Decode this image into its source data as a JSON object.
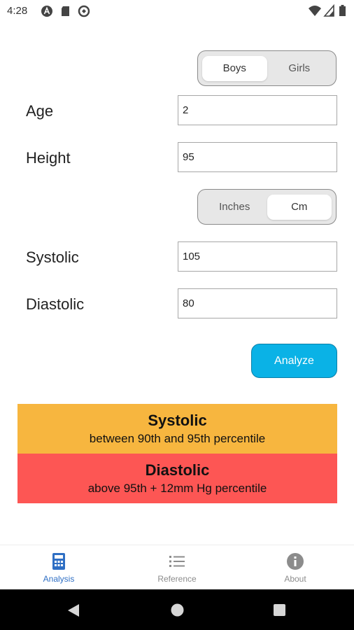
{
  "status_bar": {
    "time": "4:28",
    "icons": [
      "app-a-icon",
      "sd-card-icon",
      "sync-icon",
      "wifi-icon",
      "signal-icon",
      "battery-icon"
    ]
  },
  "gender_toggle": {
    "options": [
      "Boys",
      "Girls"
    ],
    "selected": "Boys"
  },
  "unit_toggle": {
    "options": [
      "Inches",
      "Cm"
    ],
    "selected": "Cm"
  },
  "fields": {
    "age": {
      "label": "Age",
      "value": "2"
    },
    "height": {
      "label": "Height",
      "value": "95"
    },
    "systolic": {
      "label": "Systolic",
      "value": "105"
    },
    "diastolic": {
      "label": "Diastolic",
      "value": "80"
    }
  },
  "analyze_label": "Analyze",
  "results": {
    "systolic": {
      "title": "Systolic",
      "detail": "between 90th and 95th percentile",
      "color": "#f7b63f"
    },
    "diastolic": {
      "title": "Diastolic",
      "detail": "above 95th + 12mm Hg percentile",
      "color": "#fd5654"
    }
  },
  "bottom_nav": {
    "items": [
      {
        "label": "Analysis",
        "icon": "calculator-icon",
        "active": true
      },
      {
        "label": "Reference",
        "icon": "list-icon",
        "active": false
      },
      {
        "label": "About",
        "icon": "info-icon",
        "active": false
      }
    ],
    "active_color": "#2f6fc4",
    "inactive_color": "#8c8c8c"
  },
  "colors": {
    "accent": "#0ab2e6"
  }
}
